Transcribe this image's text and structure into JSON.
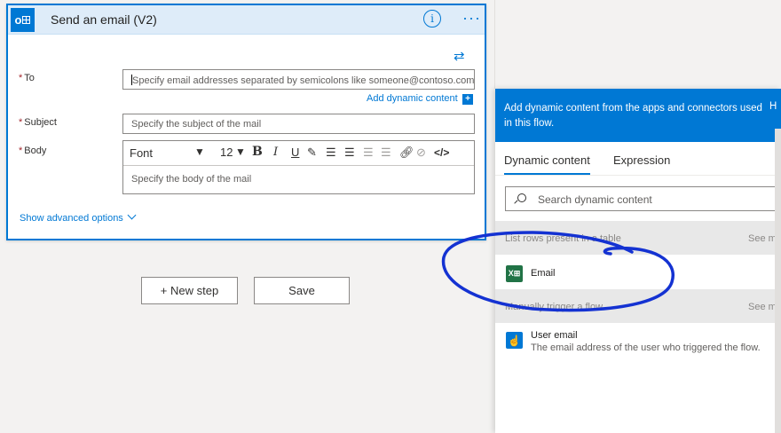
{
  "action_card": {
    "title": "Send an email (V2)",
    "info_label": "i",
    "more_label": "···",
    "fields": {
      "to": {
        "label": "To",
        "placeholder": "Specify email addresses separated by semicolons like someone@contoso.com"
      },
      "subject": {
        "label": "Subject",
        "placeholder": "Specify the subject of the mail"
      },
      "body": {
        "label": "Body",
        "placeholder": "Specify the body of the mail"
      }
    },
    "required_mark": "*",
    "add_dynamic_content": "Add dynamic content",
    "add_dynamic_plus": "+",
    "toolbar": {
      "font": "Font",
      "font_size": "12",
      "bold": "B",
      "italic": "I",
      "underline": "U",
      "code": "</>"
    },
    "show_advanced": "Show advanced options"
  },
  "buttons": {
    "new_step": "+ New step",
    "save": "Save"
  },
  "dynamic_panel": {
    "header": "Add dynamic content from the apps and connectors used in this flow.",
    "header_extra": "H",
    "tabs": [
      "Dynamic content",
      "Expression"
    ],
    "active_tab": "Dynamic content",
    "search_placeholder": "Search dynamic content",
    "sections": [
      {
        "label": "List rows present in a table",
        "see_more": "See m",
        "items": [
          {
            "title": "Email",
            "description": ""
          }
        ]
      },
      {
        "label": "Manually trigger a flow",
        "see_more": "See m",
        "items": [
          {
            "title": "User email",
            "description": "The email address of the user who triggered the flow."
          }
        ]
      }
    ]
  },
  "icons": {
    "outlook": "outlook-icon",
    "swap": "swap-icon",
    "search": "search-icon",
    "excel": "excel-icon",
    "user": "manual-trigger-icon"
  },
  "colors": {
    "accent": "#0078d4",
    "excel": "#217346",
    "annotation": "#1432d2"
  }
}
